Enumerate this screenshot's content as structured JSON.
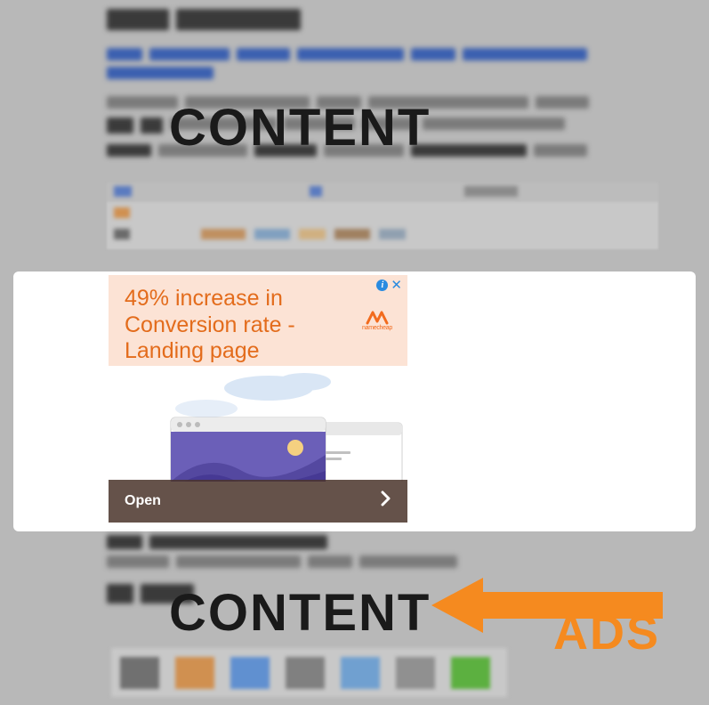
{
  "overlay": {
    "content_label": "CONTENT",
    "ads_label": "ADS"
  },
  "ad": {
    "title": "49% increase in Conversion rate - Landing page",
    "brand": "namecheap",
    "open_label": "Open",
    "info_symbol": "i",
    "close_symbol": "✕"
  }
}
